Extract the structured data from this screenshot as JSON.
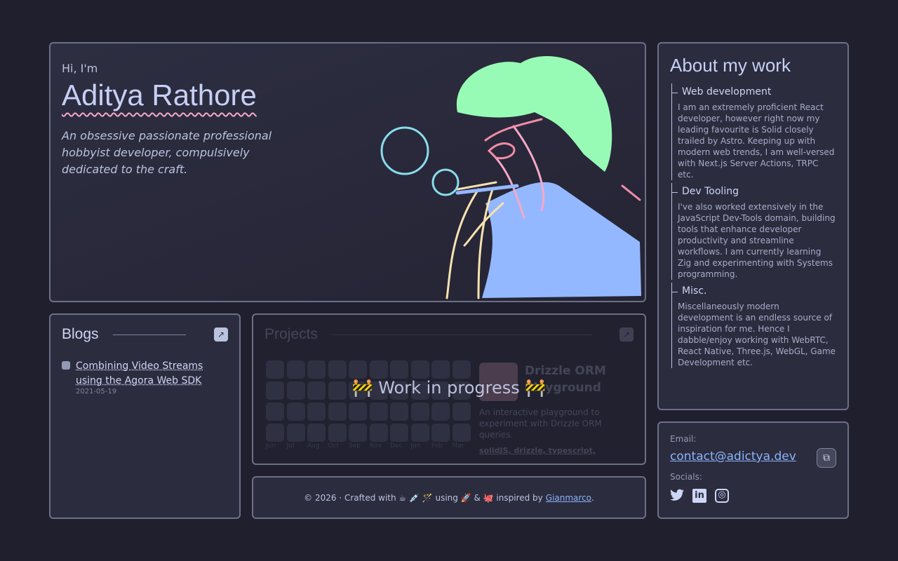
{
  "hero": {
    "greeting": "Hi, I'm",
    "name": "Aditya Rathore",
    "tagline": "An obsessive passionate professional hobbyist developer, compulsively dedicated to the craft."
  },
  "about": {
    "title": "About my work",
    "sections": [
      {
        "title": "Web development",
        "text": "I am an extremely proficient React developer, however right now my leading favourite is Solid closely trailed by Astro. Keeping up with modern web trends, I am well-versed with Next.js Server Actions, TRPC etc."
      },
      {
        "title": "Dev Tooling",
        "text": "I've also worked extensively in the JavaScript Dev-Tools domain, building tools that enhance developer productivity and streamline workflows. I am currently learning Zig and experimenting with Systems programming."
      },
      {
        "title": "Misc.",
        "text": "Miscellaneously modern development is an endless source of inspiration for me. Hence I dabble/enjoy working with WebRTC, React Native, Three.js, WebGL, Game Development etc."
      }
    ]
  },
  "blogs": {
    "title": "Blogs",
    "posts": [
      {
        "title": "Combining Video Streams using the Agora Web SDK",
        "date": "2021-05-19"
      }
    ]
  },
  "projects": {
    "title": "Projects",
    "wip": "🚧 Work in progress 🚧",
    "months": [
      "Jun",
      "Jul",
      "Aug",
      "Oct",
      "Sep",
      "Nov",
      "Dec",
      "Jan",
      "Feb",
      "Mar"
    ],
    "project": {
      "name": "Drizzle ORM Playground",
      "description": "An interactive playground to experiment with Drizzle ORM queries.",
      "tags": "solidJS, drizzle, typescript,"
    }
  },
  "footer": {
    "text": "© 2026 · Crafted with ☕ 💉 🪄 using 🚀 & 🐙 inspired by",
    "link": "Gianmarco"
  },
  "contact": {
    "email_label": "Email:",
    "email": "contact@adictya.dev",
    "socials_label": "Socials:"
  }
}
